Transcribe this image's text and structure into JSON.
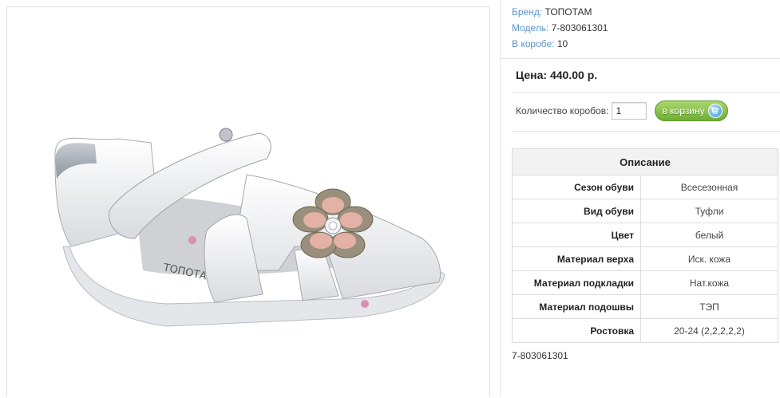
{
  "meta": [
    {
      "label": "Бренд:",
      "value": "ТОПОТАМ"
    },
    {
      "label": "Модель:",
      "value": "7-803061301"
    },
    {
      "label": "В коробе:",
      "value": "10"
    }
  ],
  "price_text": "Цена: 440.00 р.",
  "quantity": {
    "label": "Количество коробов:",
    "value": "1"
  },
  "cart_button": {
    "label": "в корзину",
    "icon": "cart-icon"
  },
  "description": {
    "title": "Описание",
    "rows": [
      {
        "key": "Сезон обуви",
        "value": "Всесезонная"
      },
      {
        "key": "Вид обуви",
        "value": "Туфли"
      },
      {
        "key": "Цвет",
        "value": "белый"
      },
      {
        "key": "Материал верха",
        "value": "Иск. кожа"
      },
      {
        "key": "Материал подкладки",
        "value": "Нат.кожа"
      },
      {
        "key": "Материал подошвы",
        "value": "ТЭП"
      },
      {
        "key": "Ростовка",
        "value": "20-24 (2,2,2,2,2)"
      }
    ]
  },
  "sku_text": "7-803061301",
  "product_image": {
    "description_icon": "sandal-photo",
    "insole_text": "ТОПОТАМ"
  }
}
